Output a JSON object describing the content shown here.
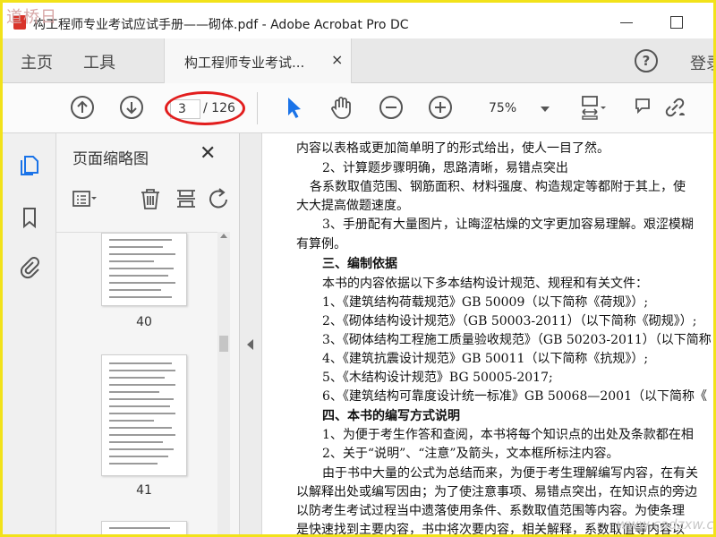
{
  "window": {
    "watermark_top": "道桥日",
    "title": "构工程师专业考试应试手册——砌体.pdf - Adobe Acrobat Pro DC"
  },
  "tabs": {
    "home": "主页",
    "tools": "工具",
    "document": "构工程师专业考试...",
    "close": "×",
    "login": "登录",
    "help": "?"
  },
  "toolbar": {
    "current_page": "3",
    "total_pages": "/ 126",
    "zoom": "75%"
  },
  "panel": {
    "title": "页面缩略图",
    "close": "✕",
    "thumbnails": [
      {
        "page": "40"
      },
      {
        "page": "41"
      }
    ]
  },
  "document": {
    "lines": [
      "内容以表格或更加简单明了的形式给出，使人一目了然。",
      "2、计算题步骤明确，思路清晰，易错点突出",
      "各系数取值范围、钢筋面积、材料强度、构造规定等都附于其上，使",
      "大大提高做题速度。",
      "3、手册配有大量图片，让晦涩枯燥的文字更加容易理解。艰涩模糊",
      "有算例。",
      "三、编制依据",
      "本书的内容依据以下多本结构设计规范、规程和有关文件：",
      "1、《建筑结构荷载规范》GB 50009（以下简称《荷规》）;",
      "2、《砌体结构设计规范》（GB 50003-2011）（以下简称《砌规》）;",
      "3、《砌体结构工程施工质量验收规范》（GB 50203-2011）（以下简称",
      "4、《建筑抗震设计规范》GB 50011（以下简称《抗规》）;",
      "5、《木结构设计规范》BG 50005-2017;",
      "6、《建筑结构可靠度设计统一标准》GB 50068—2001（以下简称《",
      "四、本书的编写方式说明",
      "1、为便于考生作答和查阅，本书将每个知识点的出处及条款都在相",
      "2、关于“说明”、“注意”及箭头，文本框所标注内容。",
      "由于书中大量的公式为总结而来，为便于考生理解编写内容，在有关",
      "以解释出处或编写因由；为了使注意事项、易错点突出，在知识点的旁边",
      "以防考生考试过程当中遗落使用条件、系数取值范围等内容。为使条理",
      "是快速找到主要内容，书中将次要内容，相关解释，系数取值等内容以"
    ],
    "watermark_bottom": "www.cadzxw.com"
  },
  "colors": {
    "frame_border": "#f2e21a",
    "annotation_ellipse": "#e21d1d",
    "select_tool_active": "#1a73e8"
  }
}
